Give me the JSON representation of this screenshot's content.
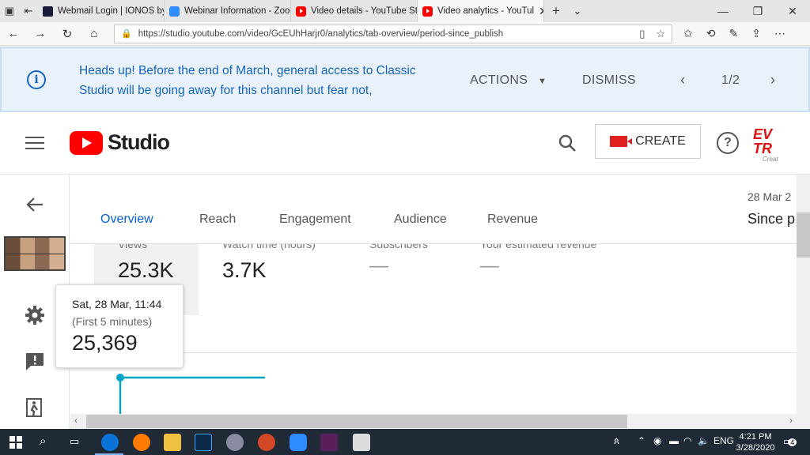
{
  "browser": {
    "tabs": [
      {
        "label": "Webmail Login | IONOS by",
        "icon": "ionos-icon"
      },
      {
        "label": "Webinar Information - Zoor",
        "icon": "zoom-icon"
      },
      {
        "label": "Video details - YouTube Stu",
        "icon": "youtube-icon"
      },
      {
        "label": "Video analytics - YouTul",
        "icon": "youtube-icon"
      }
    ],
    "url": "https://studio.youtube.com/video/GcEUhHarjr0/analytics/tab-overview/period-since_publish"
  },
  "banner": {
    "message": "Heads up! Before the end of March, general access to Classic Studio will be going away for this channel but fear not,",
    "actions_label": "ACTIONS",
    "dismiss_label": "DISMISS",
    "pager": "1/2"
  },
  "header": {
    "logo_text": "Studio",
    "create_label": "CREATE",
    "help_symbol": "?",
    "avatar_text": "EV TR",
    "avatar_sub": "Creat"
  },
  "analytics": {
    "tabs": [
      "Overview",
      "Reach",
      "Engagement",
      "Audience",
      "Revenue"
    ],
    "date_top": "28 Mar 2",
    "date_range": "Since p",
    "metrics": [
      {
        "label": "Views",
        "value": "25.3K"
      },
      {
        "label": "Watch time (hours)",
        "value": "3.7K"
      },
      {
        "label": "Subscribers",
        "value": "—"
      },
      {
        "label": "Your estimated revenue",
        "value": "—"
      }
    ]
  },
  "tooltip": {
    "date": "Sat, 28 Mar, 11:44",
    "note": "(First 5 minutes)",
    "value": "25,369"
  },
  "taskbar": {
    "time": "4:21 PM",
    "date": "3/28/2020",
    "lang": "ENG",
    "notif_count": "4"
  },
  "colors": {
    "accent": "#065fd4",
    "banner_text": "#1565c0",
    "line": "#00a5c8",
    "youtube_red": "#ff0000"
  }
}
